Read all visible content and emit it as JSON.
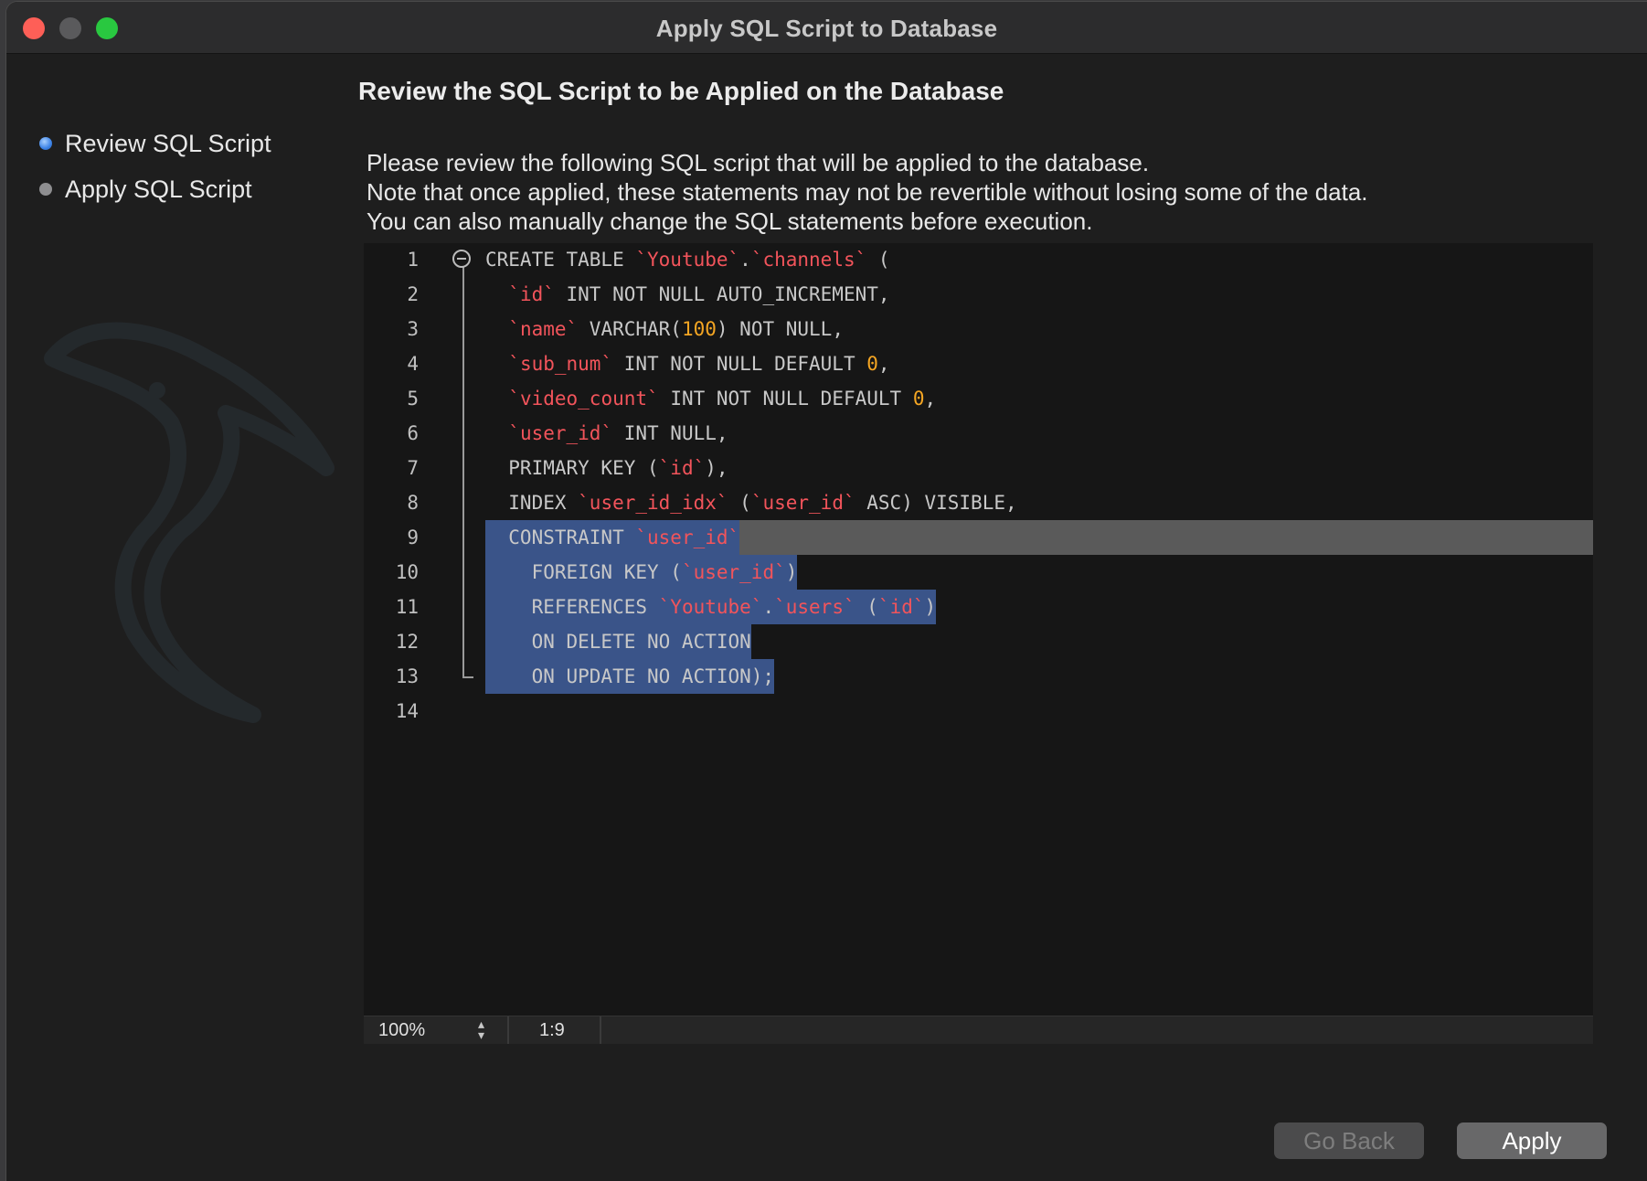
{
  "window": {
    "title": "Apply SQL Script to Database"
  },
  "steps": [
    {
      "label": "Review SQL Script",
      "active": true
    },
    {
      "label": "Apply SQL Script",
      "active": false
    }
  ],
  "heading": "Review the SQL Script to be Applied on the Database",
  "description": [
    "Please review the following SQL script that will be applied to the database.",
    "Note that once applied, these statements may not be revertible without losing some of the data.",
    "You can also manually change the SQL statements before execution."
  ],
  "editor": {
    "line_numbers": [
      "1",
      "2",
      "3",
      "4",
      "5",
      "6",
      "7",
      "8",
      "9",
      "10",
      "11",
      "12",
      "13",
      "14"
    ],
    "lines": [
      [
        [
          "p",
          "CREATE TABLE "
        ],
        [
          "s",
          "`Youtube`"
        ],
        [
          "p",
          "."
        ],
        [
          "s",
          "`channels`"
        ],
        [
          "p",
          " ("
        ]
      ],
      [
        [
          "p",
          "  "
        ],
        [
          "s",
          "`id`"
        ],
        [
          "p",
          " INT NOT NULL AUTO_INCREMENT,"
        ]
      ],
      [
        [
          "p",
          "  "
        ],
        [
          "s",
          "`name`"
        ],
        [
          "p",
          " VARCHAR("
        ],
        [
          "n",
          "100"
        ],
        [
          "p",
          ") NOT NULL,"
        ]
      ],
      [
        [
          "p",
          "  "
        ],
        [
          "s",
          "`sub_num`"
        ],
        [
          "p",
          " INT NOT NULL DEFAULT "
        ],
        [
          "n",
          "0"
        ],
        [
          "p",
          ","
        ]
      ],
      [
        [
          "p",
          "  "
        ],
        [
          "s",
          "`video_count`"
        ],
        [
          "p",
          " INT NOT NULL DEFAULT "
        ],
        [
          "n",
          "0"
        ],
        [
          "p",
          ","
        ]
      ],
      [
        [
          "p",
          "  "
        ],
        [
          "s",
          "`user_id`"
        ],
        [
          "p",
          " INT NULL,"
        ]
      ],
      [
        [
          "p",
          "  PRIMARY KEY ("
        ],
        [
          "s",
          "`id`"
        ],
        [
          "p",
          "),"
        ]
      ],
      [
        [
          "p",
          "  INDEX "
        ],
        [
          "s",
          "`user_id_idx`"
        ],
        [
          "p",
          " ("
        ],
        [
          "s",
          "`user_id`"
        ],
        [
          "p",
          " ASC) VISIBLE,"
        ]
      ],
      [
        [
          "p",
          "  CONSTRAINT "
        ],
        [
          "s",
          "`user_id`"
        ]
      ],
      [
        [
          "p",
          "    FOREIGN KEY ("
        ],
        [
          "s",
          "`user_id`"
        ],
        [
          "p",
          ")"
        ]
      ],
      [
        [
          "p",
          "    REFERENCES "
        ],
        [
          "s",
          "`Youtube`"
        ],
        [
          "p",
          "."
        ],
        [
          "s",
          "`users`"
        ],
        [
          "p",
          " ("
        ],
        [
          "s",
          "`id`"
        ],
        [
          "p",
          ")"
        ]
      ],
      [
        [
          "p",
          "    ON DELETE NO ACTION"
        ]
      ],
      [
        [
          "p",
          "    ON UPDATE NO ACTION);"
        ]
      ],
      []
    ],
    "current_line": 9,
    "selected_lines": [
      9,
      10,
      11,
      12,
      13
    ]
  },
  "status": {
    "zoom": "100%",
    "cursor_position": "1:9"
  },
  "buttons": {
    "back": "Go Back",
    "apply": "Apply"
  },
  "colors": {
    "string": "#f2545b",
    "number": "#f5a623",
    "selection": "#3a5489",
    "current_line": "#5a5a5a"
  }
}
